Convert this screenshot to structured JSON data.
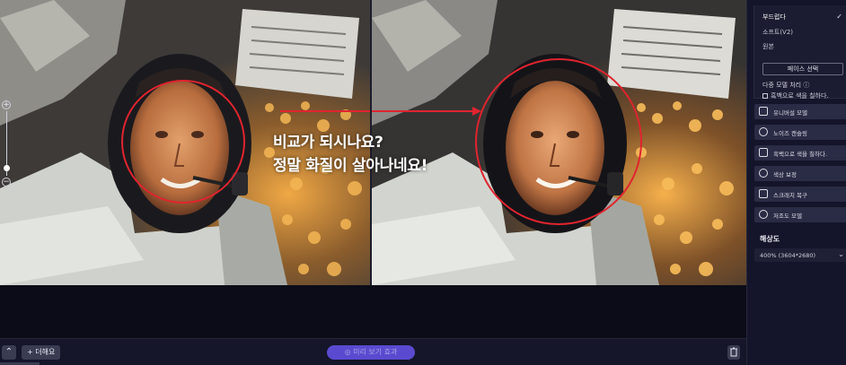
{
  "caption": {
    "line1": "비교가 되시나요?",
    "line2": "정말 화질이 살아나네요!"
  },
  "bottom_bar": {
    "up_icon": "chevron-up-icon",
    "add_label": "+ 더해요",
    "compare_label": "미리 보기 효과",
    "compare_icon": "eye-icon",
    "trash_icon": "trash-icon"
  },
  "zoom": {
    "plus": "+",
    "minus": "−"
  },
  "panel": {
    "models": [
      "부드럽다",
      "소프트(V2)",
      "원본"
    ],
    "selected_model_index": 0,
    "face_select_label": "페이스 선택",
    "multi_model_label": "다중 모델 처리 ⓘ",
    "bw_colorize_label": "흑백으로 색을 칠하다.",
    "tools": [
      {
        "label": "유니버설 모델",
        "icon": "image-icon"
      },
      {
        "label": "노이즈 캔슬링",
        "icon": "noise-icon"
      },
      {
        "label": "흑백으로 색을 칠하다.",
        "icon": "paint-icon"
      },
      {
        "label": "색상 보정",
        "icon": "sun-icon"
      },
      {
        "label": "스크래치 복구",
        "icon": "scratch-icon"
      },
      {
        "label": "저조도 모델",
        "icon": "contrast-icon"
      }
    ],
    "resolution_title": "해상도",
    "resolution_value": "400% (3604*2680)"
  },
  "colors": {
    "accent": "#5a4ad0",
    "annotation": "#e0242f",
    "panel_bg": "#14152a"
  }
}
